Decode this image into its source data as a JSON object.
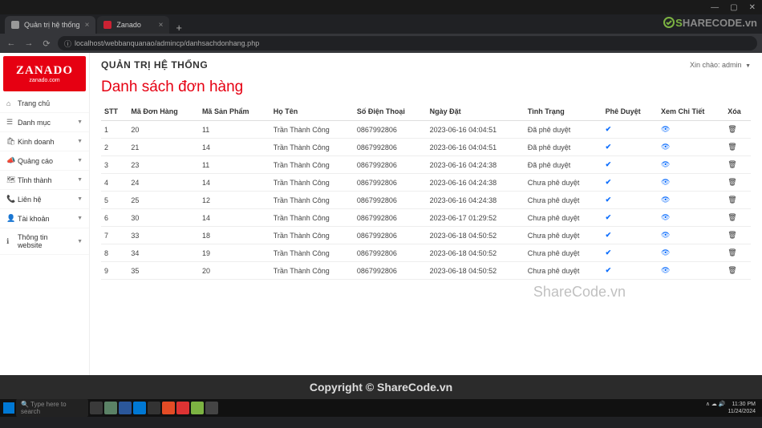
{
  "browser": {
    "tabs": [
      {
        "title": "Quản trị hệ thống",
        "active": true
      },
      {
        "title": "Zanado",
        "active": false
      }
    ],
    "url": "localhost/webbanquanao/admincp/danhsachdonhang.php"
  },
  "sidebar": {
    "brand_name": "ZANADO",
    "brand_sub": "zanado.com",
    "items": [
      {
        "icon": "home",
        "label": "Trang chủ",
        "caret": false
      },
      {
        "icon": "list",
        "label": "Danh mục",
        "caret": true
      },
      {
        "icon": "bag",
        "label": "Kinh doanh",
        "caret": true
      },
      {
        "icon": "bullhorn",
        "label": "Quảng cáo",
        "caret": true
      },
      {
        "icon": "map",
        "label": "Tỉnh thành",
        "caret": true
      },
      {
        "icon": "phone",
        "label": "Liên hệ",
        "caret": true
      },
      {
        "icon": "user",
        "label": "Tài khoản",
        "caret": true
      },
      {
        "icon": "info",
        "label": "Thông tin website",
        "caret": true
      }
    ]
  },
  "header": {
    "admin_title": "QUẢN TRỊ HỆ THỐNG",
    "welcome_prefix": "Xin chào: ",
    "welcome_user": "admin"
  },
  "page_title": "Danh sách đơn hàng",
  "table": {
    "headers": [
      "STT",
      "Mã Đơn Hàng",
      "Mã Sản Phẩm",
      "Họ Tên",
      "Số Điện Thoại",
      "Ngày Đặt",
      "Tình Trạng",
      "Phê Duyệt",
      "Xem Chi Tiết",
      "Xóa"
    ],
    "rows": [
      {
        "stt": "1",
        "order_id": "20",
        "product_id": "11",
        "name": "Trần Thành Công",
        "phone": "0867992806",
        "date": "2023-06-16 04:04:51",
        "status": "Đã phê duyệt"
      },
      {
        "stt": "2",
        "order_id": "21",
        "product_id": "14",
        "name": "Trần Thành Công",
        "phone": "0867992806",
        "date": "2023-06-16 04:04:51",
        "status": "Đã phê duyệt"
      },
      {
        "stt": "3",
        "order_id": "23",
        "product_id": "11",
        "name": "Trần Thành Công",
        "phone": "0867992806",
        "date": "2023-06-16 04:24:38",
        "status": "Đã phê duyệt"
      },
      {
        "stt": "4",
        "order_id": "24",
        "product_id": "14",
        "name": "Trần Thành Công",
        "phone": "0867992806",
        "date": "2023-06-16 04:24:38",
        "status": "Chưa phê duyệt"
      },
      {
        "stt": "5",
        "order_id": "25",
        "product_id": "12",
        "name": "Trần Thành Công",
        "phone": "0867992806",
        "date": "2023-06-16 04:24:38",
        "status": "Chưa phê duyệt"
      },
      {
        "stt": "6",
        "order_id": "30",
        "product_id": "14",
        "name": "Trần Thành Công",
        "phone": "0867992806",
        "date": "2023-06-17 01:29:52",
        "status": "Chưa phê duyệt"
      },
      {
        "stt": "7",
        "order_id": "33",
        "product_id": "18",
        "name": "Trần Thành Công",
        "phone": "0867992806",
        "date": "2023-06-18 04:50:52",
        "status": "Chưa phê duyệt"
      },
      {
        "stt": "8",
        "order_id": "34",
        "product_id": "19",
        "name": "Trần Thành Công",
        "phone": "0867992806",
        "date": "2023-06-18 04:50:52",
        "status": "Chưa phê duyệt"
      },
      {
        "stt": "9",
        "order_id": "35",
        "product_id": "20",
        "name": "Trần Thành Công",
        "phone": "0867992806",
        "date": "2023-06-18 04:50:52",
        "status": "Chưa phê duyệt"
      }
    ]
  },
  "footer": "Copyright © ShareCode.vn",
  "watermark_logo": {
    "prefix": "S",
    "rest": "HARECODE.vn"
  },
  "watermark_text": "ShareCode.vn",
  "taskbar": {
    "search_placeholder": "Type here to search",
    "time": "11:30 PM",
    "date": "11/24/2024"
  }
}
